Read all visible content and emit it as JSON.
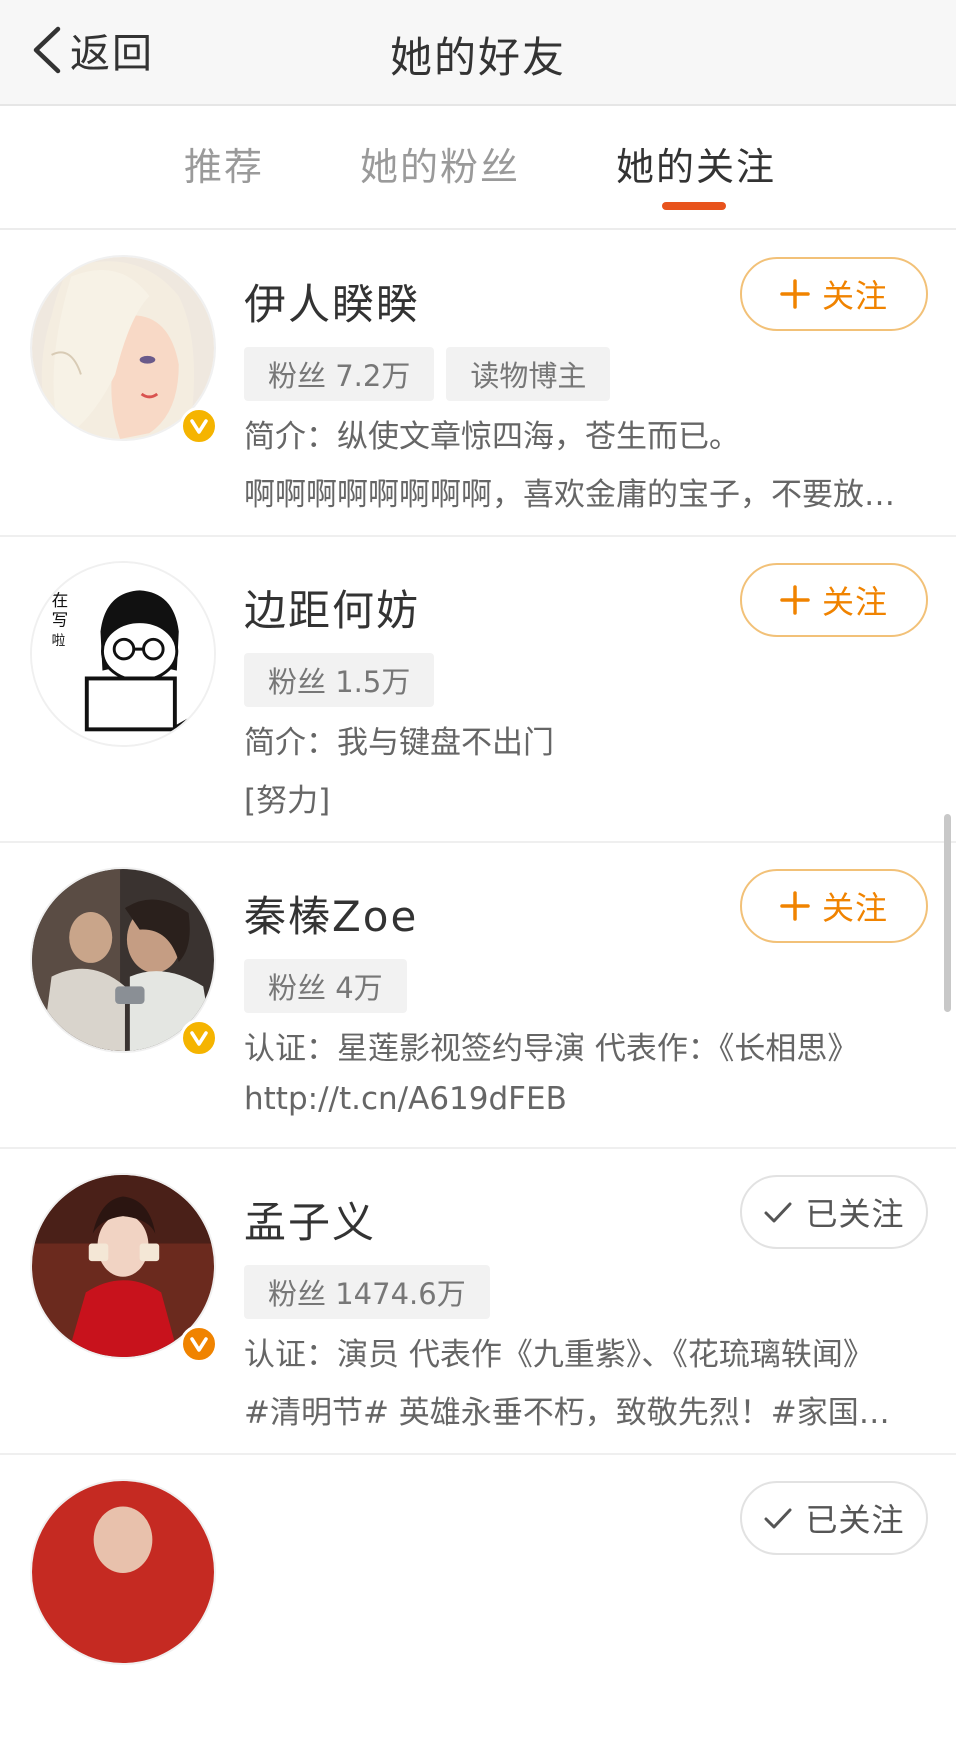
{
  "nav": {
    "back_label": "返回",
    "title": "她的好友"
  },
  "tabs": [
    {
      "label": "推荐",
      "active": false
    },
    {
      "label": "她的粉丝",
      "active": false
    },
    {
      "label": "她的关注",
      "active": true
    }
  ],
  "accent_color": "#e8531c",
  "follow_color": "#f08300",
  "users": [
    {
      "name": "伊人睽睽",
      "fans": "粉丝 7.2万",
      "extra_tag": "读物博主",
      "line1": "简介：纵使文章惊四海，苍生而已。",
      "line2": "啊啊啊啊啊啊啊啊，喜欢金庸的宝子，不要放…",
      "verified": true,
      "button": "关注",
      "followed": false
    },
    {
      "name": "边距何妨",
      "fans": "粉丝 1.5万",
      "line1": "简介：我与键盘不出门",
      "line2": "[努力]",
      "verified": false,
      "button": "关注",
      "followed": false,
      "avatar_text": [
        "在",
        "写",
        "啦"
      ]
    },
    {
      "name": "秦榛Zoe",
      "fans": "粉丝 4万",
      "line1": "认证：星莲影视签约导演 代表作：《长相思》",
      "line2": "http://t.cn/A619dFEB",
      "verified": true,
      "button": "关注",
      "followed": false
    },
    {
      "name": "孟子义",
      "fans": "粉丝 1474.6万",
      "line1": "认证：演员 代表作《九重紫》、《花琉璃轶闻》",
      "line2": "#清明节# 英雄永垂不朽，致敬先烈！#家国永…",
      "verified": true,
      "button": "已关注",
      "followed": true
    },
    {
      "name": "",
      "button": "已关注",
      "followed": true
    }
  ]
}
